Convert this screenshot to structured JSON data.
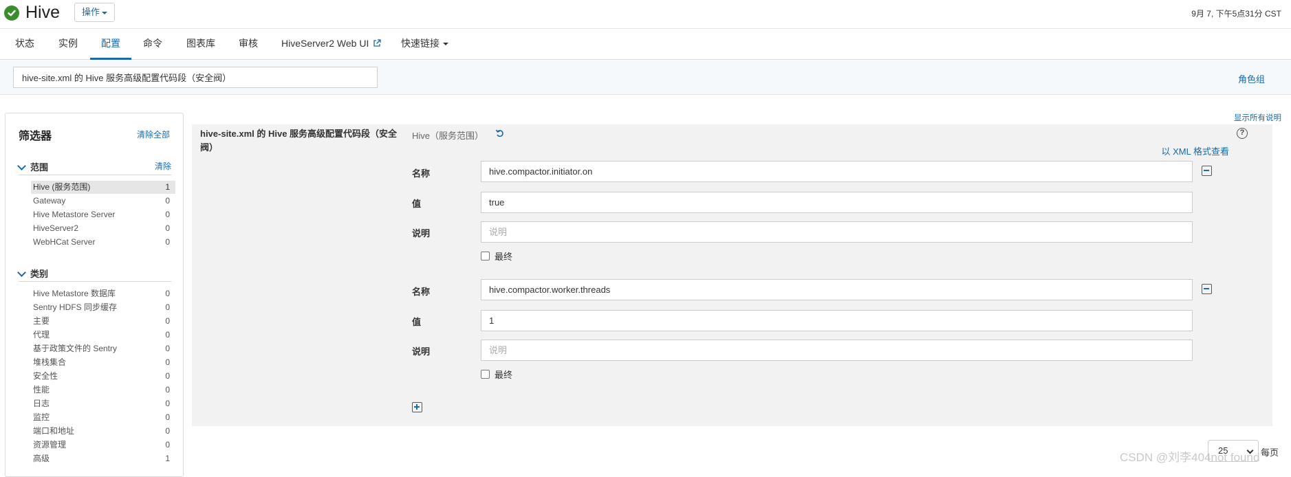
{
  "header": {
    "title": "Hive",
    "actions_label": "操作",
    "timestamp": "9月 7, 下午5点31分 CST"
  },
  "tabs": [
    {
      "label": "状态"
    },
    {
      "label": "实例"
    },
    {
      "label": "配置",
      "active": true
    },
    {
      "label": "命令"
    },
    {
      "label": "图表库"
    },
    {
      "label": "审核"
    },
    {
      "label": "HiveServer2 Web UI",
      "external": true
    },
    {
      "label": "快速链接",
      "dropdown": true
    }
  ],
  "search": {
    "value": "hive-site.xml 的 Hive 服务高级配置代码段（安全阀）"
  },
  "role_group_label": "角色组",
  "show_all_desc_label": "显示所有说明",
  "filters": {
    "title": "筛选器",
    "clear_all": "清除全部",
    "scope": {
      "label": "范围",
      "clear": "清除",
      "items": [
        {
          "label": "Hive (服务范围)",
          "count": "1",
          "selected": true
        },
        {
          "label": "Gateway",
          "count": "0"
        },
        {
          "label": "Hive Metastore Server",
          "count": "0"
        },
        {
          "label": "HiveServer2",
          "count": "0"
        },
        {
          "label": "WebHCat Server",
          "count": "0"
        }
      ]
    },
    "category": {
      "label": "类别",
      "items": [
        {
          "label": "Hive Metastore 数据库",
          "count": "0"
        },
        {
          "label": "Sentry HDFS 同步缓存",
          "count": "0"
        },
        {
          "label": "主要",
          "count": "0"
        },
        {
          "label": "代理",
          "count": "0"
        },
        {
          "label": "基于政策文件的 Sentry",
          "count": "0"
        },
        {
          "label": "堆栈集合",
          "count": "0"
        },
        {
          "label": "安全性",
          "count": "0"
        },
        {
          "label": "性能",
          "count": "0"
        },
        {
          "label": "日志",
          "count": "0"
        },
        {
          "label": "监控",
          "count": "0"
        },
        {
          "label": "端口和地址",
          "count": "0"
        },
        {
          "label": "资源管理",
          "count": "0"
        },
        {
          "label": "高级",
          "count": "1"
        }
      ]
    }
  },
  "config": {
    "property_title": "hive-site.xml 的 Hive 服务高级配置代码段（安全阀）",
    "scope": "Hive（服务范围）",
    "xml_link": "以 XML 格式查看",
    "help": "?",
    "labels": {
      "name": "名称",
      "value": "值",
      "desc": "说明",
      "final": "最终"
    },
    "entries": [
      {
        "name": "hive.compactor.initiator.on",
        "value": "true",
        "desc_placeholder": "说明",
        "final": false
      },
      {
        "name": "hive.compactor.worker.threads",
        "value": "1",
        "desc_placeholder": "说明",
        "final": false
      }
    ]
  },
  "pagination": {
    "per_page_value": "25",
    "per_page_label": "每页"
  },
  "watermark": "CSDN @刘李404not found",
  "colors": {
    "accent": "#1a6aa8",
    "status_ok": "#3a8d2c",
    "panel_bg": "#f2f2f2"
  }
}
